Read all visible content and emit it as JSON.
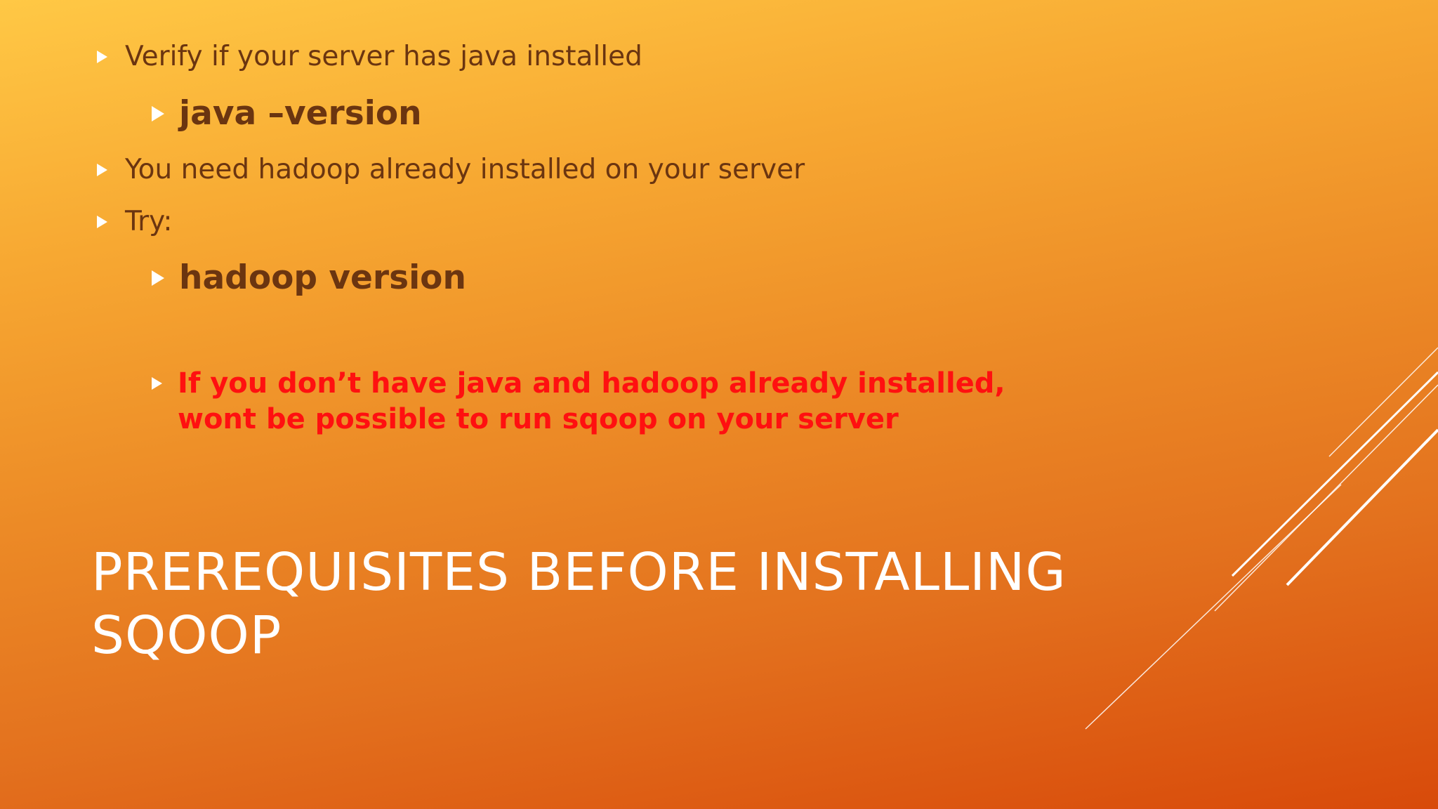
{
  "slide": {
    "bullets": {
      "b1": "Verify if your server has java installed",
      "b1_sub": "java –version",
      "b2": "You need hadoop already installed on your server",
      "b3": "Try:",
      "b3_sub": "hadoop version",
      "warning": "If you don’t have java and hadoop already installed, wont be possible to run sqoop on your server"
    },
    "title": "PREREQUISITES BEFORE INSTALLING SQOOP"
  },
  "colors": {
    "background_top": "#ffc845",
    "background_bottom": "#d84a0a",
    "body_text": "#6b3510",
    "warning_text": "#ff1010",
    "title_text": "#ffffff"
  }
}
